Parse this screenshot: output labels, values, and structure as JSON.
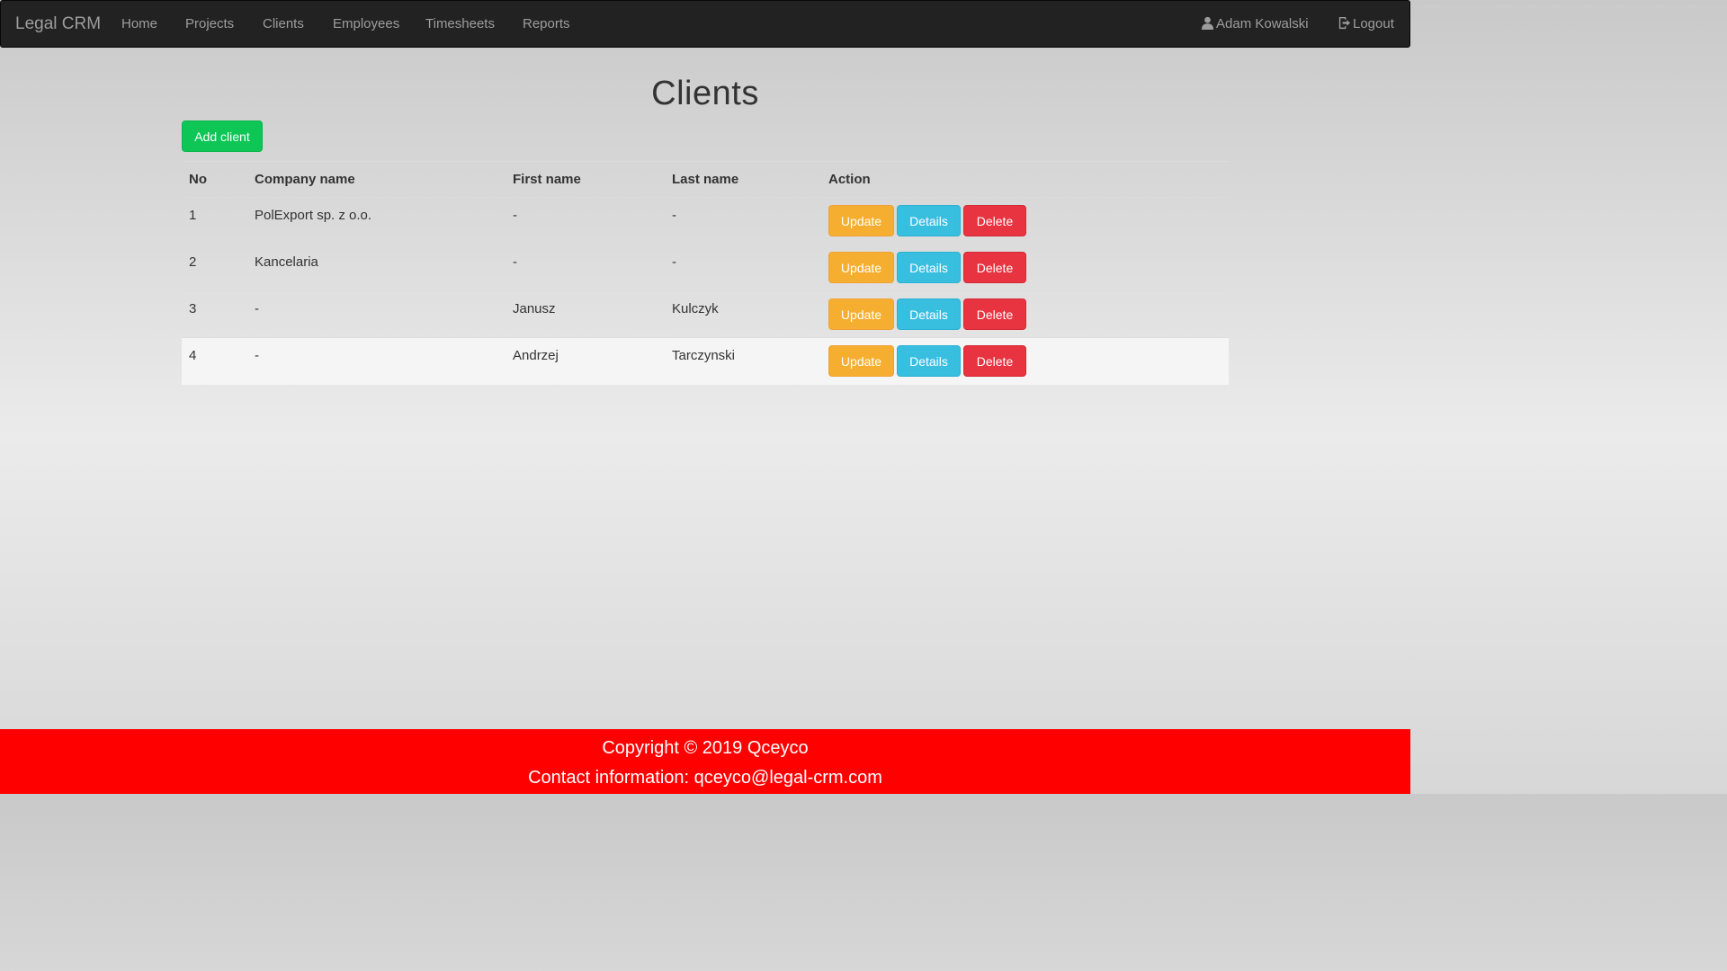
{
  "navbar": {
    "brand": "Legal CRM",
    "links": [
      "Home",
      "Projects",
      "Clients",
      "Employees",
      "Timesheets",
      "Reports"
    ],
    "user_name": "Adam Kowalski",
    "logout_label": "Logout",
    "user_icon": "user-icon",
    "logout_icon": "logout-icon"
  },
  "page": {
    "title": "Clients",
    "add_button_label": "Add client"
  },
  "table": {
    "headers": [
      "No",
      "Company name",
      "First name",
      "Last name",
      "Action"
    ],
    "rows": [
      {
        "no": "1",
        "company": "PolExport sp. z o.o.",
        "first_name": "-",
        "last_name": "-"
      },
      {
        "no": "2",
        "company": "Kancelaria",
        "first_name": "-",
        "last_name": "-"
      },
      {
        "no": "3",
        "company": "-",
        "first_name": "Janusz",
        "last_name": "Kulczyk"
      },
      {
        "no": "4",
        "company": "-",
        "first_name": "Andrzej",
        "last_name": "Tarczynski"
      }
    ],
    "actions": {
      "update_label": "Update",
      "details_label": "Details",
      "delete_label": "Delete"
    }
  },
  "footer": {
    "copyright": "Copyright © 2019 Qceyco",
    "contact": "Contact information: qceyco@legal-crm.com"
  },
  "colors": {
    "navbar_bg": "#222222",
    "add_button": "#0dc655",
    "update_button": "#f6ae30",
    "details_button": "#38bfe0",
    "delete_button": "#e83340",
    "footer_bg": "#ff0000"
  }
}
